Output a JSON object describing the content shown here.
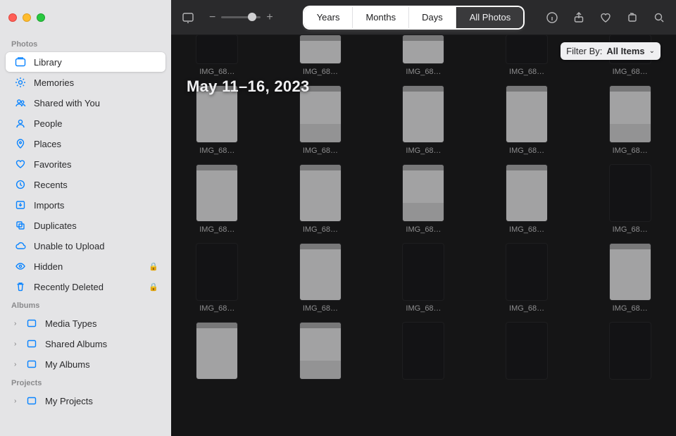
{
  "sidebar": {
    "sections": {
      "photos": "Photos",
      "albums": "Albums",
      "projects": "Projects"
    },
    "items": {
      "library": "Library",
      "memories": "Memories",
      "shared_with_you": "Shared with You",
      "people": "People",
      "places": "Places",
      "favorites": "Favorites",
      "recents": "Recents",
      "imports": "Imports",
      "duplicates": "Duplicates",
      "unable_to_upload": "Unable to Upload",
      "hidden": "Hidden",
      "recently_deleted": "Recently Deleted",
      "media_types": "Media Types",
      "shared_albums": "Shared Albums",
      "my_albums": "My Albums",
      "my_projects": "My Projects"
    }
  },
  "toolbar": {
    "view_segments": {
      "years": "Years",
      "months": "Months",
      "days": "Days",
      "all_photos": "All Photos"
    }
  },
  "filter": {
    "label": "Filter By:",
    "value": "All Items"
  },
  "content": {
    "date_header": "May 11–16, 2023",
    "caption": "IMG_68…"
  }
}
